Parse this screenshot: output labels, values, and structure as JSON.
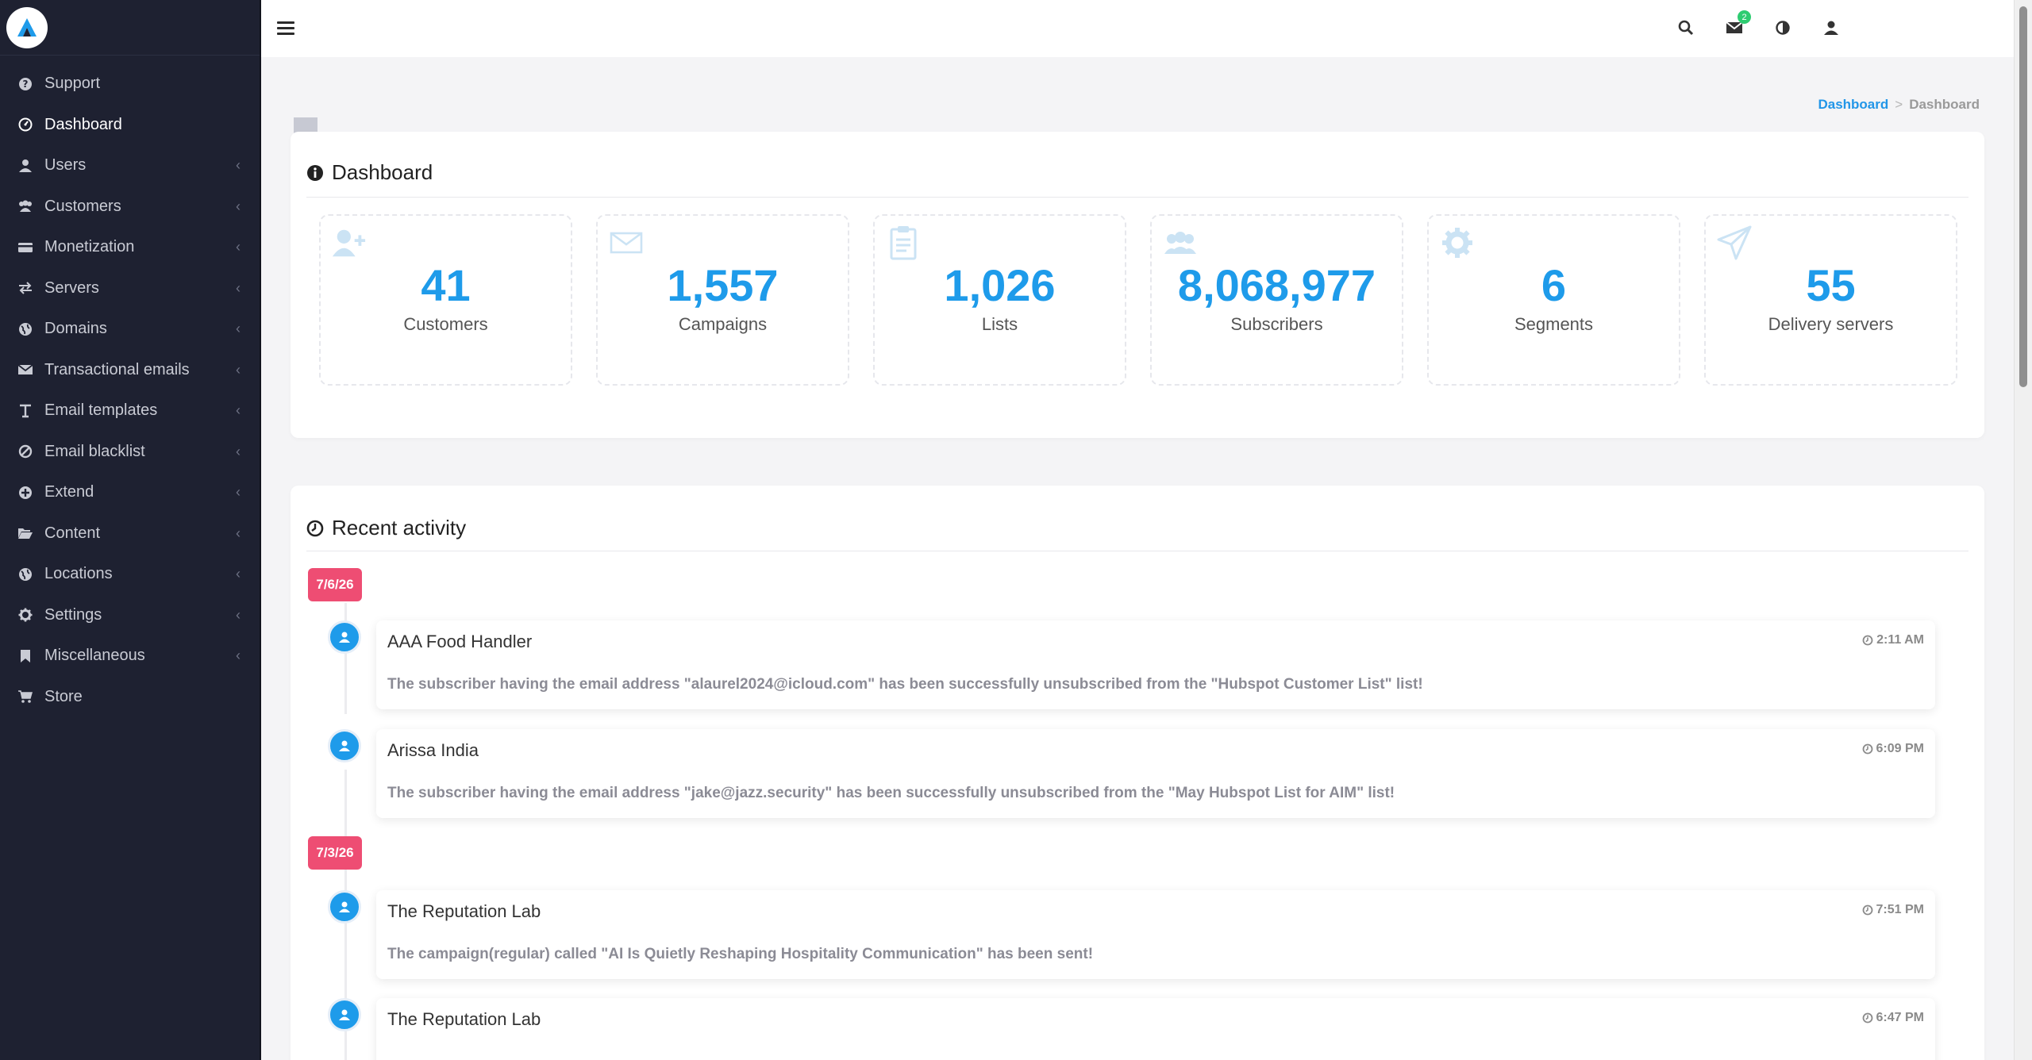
{
  "sidebar": {
    "items": [
      {
        "label": "Support",
        "icon": "question-circle-icon",
        "chevron": ""
      },
      {
        "label": "Dashboard",
        "icon": "dashboard-icon",
        "chevron": ""
      },
      {
        "label": "Users",
        "icon": "user-icon",
        "chevron": "‹"
      },
      {
        "label": "Customers",
        "icon": "users-icon",
        "chevron": "‹"
      },
      {
        "label": "Monetization",
        "icon": "credit-card-icon",
        "chevron": "‹"
      },
      {
        "label": "Servers",
        "icon": "transfer-icon",
        "chevron": "‹"
      },
      {
        "label": "Domains",
        "icon": "globe-icon",
        "chevron": "‹"
      },
      {
        "label": "Transactional emails",
        "icon": "envelope-icon",
        "chevron": "‹"
      },
      {
        "label": "Email templates",
        "icon": "text-icon",
        "chevron": "‹"
      },
      {
        "label": "Email blacklist",
        "icon": "ban-icon",
        "chevron": "‹"
      },
      {
        "label": "Extend",
        "icon": "plus-circle-icon",
        "chevron": "‹"
      },
      {
        "label": "Content",
        "icon": "folder-open-icon",
        "chevron": "‹"
      },
      {
        "label": "Locations",
        "icon": "globe-icon",
        "chevron": "‹"
      },
      {
        "label": "Settings",
        "icon": "gear-icon",
        "chevron": "‹"
      },
      {
        "label": "Miscellaneous",
        "icon": "bookmark-icon",
        "chevron": "‹"
      },
      {
        "label": "Store",
        "icon": "cart-icon",
        "chevron": ""
      }
    ]
  },
  "topbar": {
    "notification_count": "2"
  },
  "breadcrumb": {
    "link": "Dashboard",
    "separator": ">",
    "current": "Dashboard"
  },
  "dashboard": {
    "title": "Dashboard",
    "stats": [
      {
        "value": "41",
        "label": "Customers",
        "icon": "user-plus-icon"
      },
      {
        "value": "1,557",
        "label": "Campaigns",
        "icon": "envelope-icon"
      },
      {
        "value": "1,026",
        "label": "Lists",
        "icon": "clipboard-icon"
      },
      {
        "value": "8,068,977",
        "label": "Subscribers",
        "icon": "users-icon"
      },
      {
        "value": "6",
        "label": "Segments",
        "icon": "gear-icon"
      },
      {
        "value": "55",
        "label": "Delivery servers",
        "icon": "paper-plane-icon"
      }
    ]
  },
  "activity": {
    "title": "Recent activity",
    "groups": [
      {
        "date": "7/6/26",
        "items": [
          {
            "name": "AAA Food Handler",
            "time": "2:11 AM",
            "message": "The subscriber having the email address \"alaurel2024@icloud.com\" has been successfully unsubscribed from the \"Hubspot Customer List\" list!"
          },
          {
            "name": "Arissa India",
            "time": "6:09 PM",
            "message": "The subscriber having the email address \"jake@jazz.security\" has been successfully unsubscribed from the \"May Hubspot List for AIM\" list!"
          }
        ]
      },
      {
        "date": "7/3/26",
        "items": [
          {
            "name": "The Reputation Lab",
            "time": "7:51 PM",
            "message": "The campaign(regular) called \"AI Is Quietly Reshaping Hospitality Communication\" has been sent!"
          },
          {
            "name": "The Reputation Lab",
            "time": "6:47 PM",
            "message": ""
          }
        ]
      }
    ]
  }
}
